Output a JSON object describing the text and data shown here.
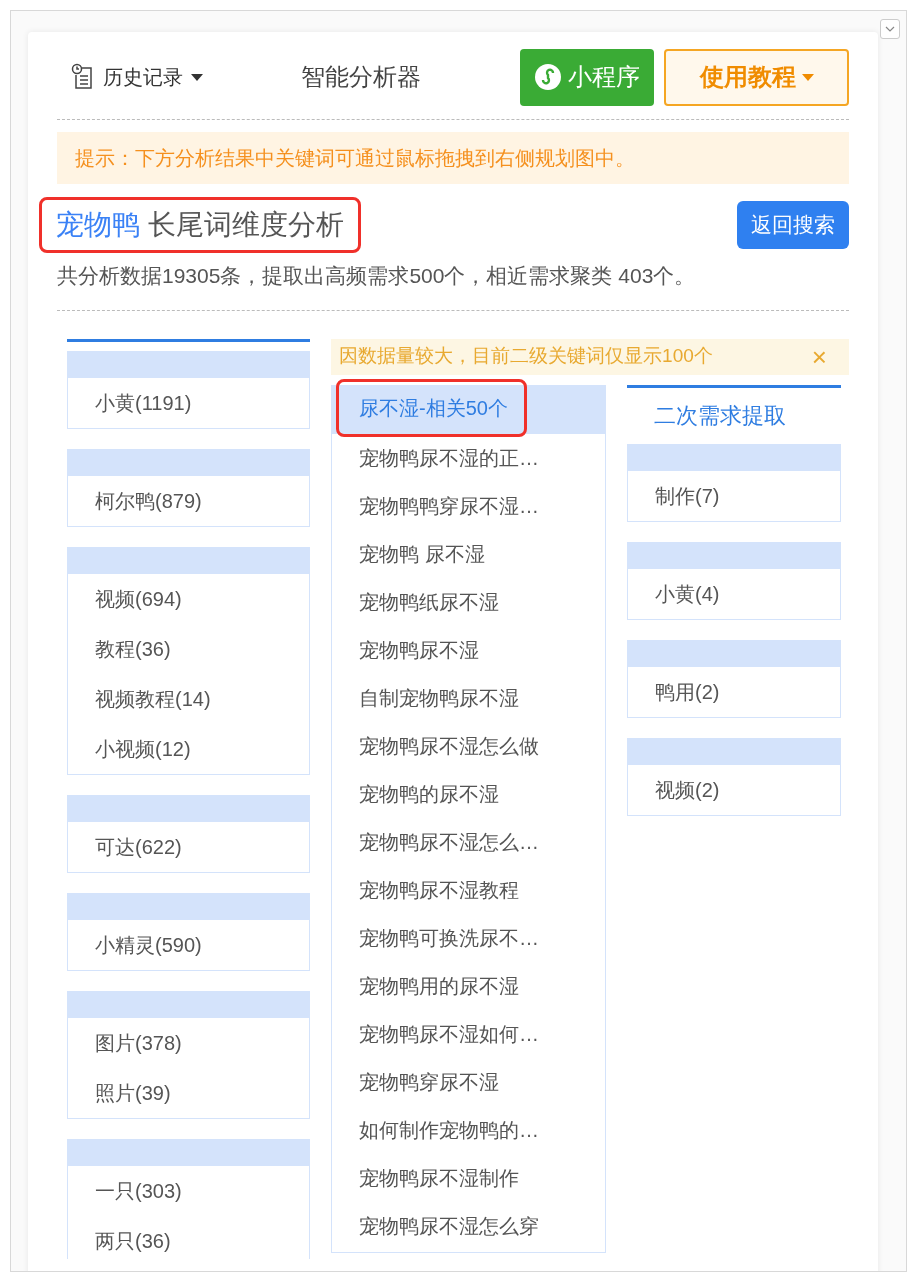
{
  "toolbar": {
    "history": "历史记录",
    "title": "智能分析器",
    "miniprogram": "小程序",
    "tutorial": "使用教程"
  },
  "tip": "提示：下方分析结果中关键词可通过鼠标拖拽到右侧规划图中。",
  "heading": {
    "keyword": "宠物鸭",
    "text": "长尾词维度分析",
    "annotated": true
  },
  "back_button": "返回搜索",
  "summary": "共分析数据19305条，提取出高频需求500个，相近需求聚类 403个。",
  "groups": [
    {
      "items": [
        "小黄(1191)"
      ]
    },
    {
      "items": [
        "柯尔鸭(879)"
      ]
    },
    {
      "items": [
        "视频(694)",
        "教程(36)",
        "视频教程(14)",
        "小视频(12)"
      ]
    },
    {
      "items": [
        "可达(622)"
      ]
    },
    {
      "items": [
        "小精灵(590)"
      ]
    },
    {
      "items": [
        "图片(378)",
        "照片(39)"
      ]
    },
    {
      "items": [
        "一只(303)",
        "两只(36)"
      ]
    }
  ],
  "notice": {
    "text": "因数据量较大，目前二级关键词仅显示100个",
    "close": "×"
  },
  "related": {
    "header": {
      "text": "尿不湿-相关50个",
      "selected": true,
      "annotated": true
    },
    "items": [
      "宠物鸭尿不湿的正…",
      "宠物鸭鸭穿尿不湿…",
      "宠物鸭 尿不湿",
      "宠物鸭纸尿不湿",
      "宠物鸭尿不湿",
      "自制宠物鸭尿不湿",
      "宠物鸭尿不湿怎么做",
      "宠物鸭的尿不湿",
      "宠物鸭尿不湿怎么…",
      "宠物鸭尿不湿教程",
      "宠物鸭可换洗尿不…",
      "宠物鸭用的尿不湿",
      "宠物鸭尿不湿如何…",
      "宠物鸭穿尿不湿",
      "如何制作宠物鸭的…",
      "宠物鸭尿不湿制作",
      "宠物鸭尿不湿怎么穿"
    ]
  },
  "secondary": {
    "title": "二次需求提取",
    "groups": [
      {
        "items": [
          "制作(7)"
        ]
      },
      {
        "items": [
          "小黄(4)"
        ]
      },
      {
        "items": [
          "鸭用(2)"
        ]
      },
      {
        "items": [
          "视频(2)"
        ]
      }
    ]
  }
}
